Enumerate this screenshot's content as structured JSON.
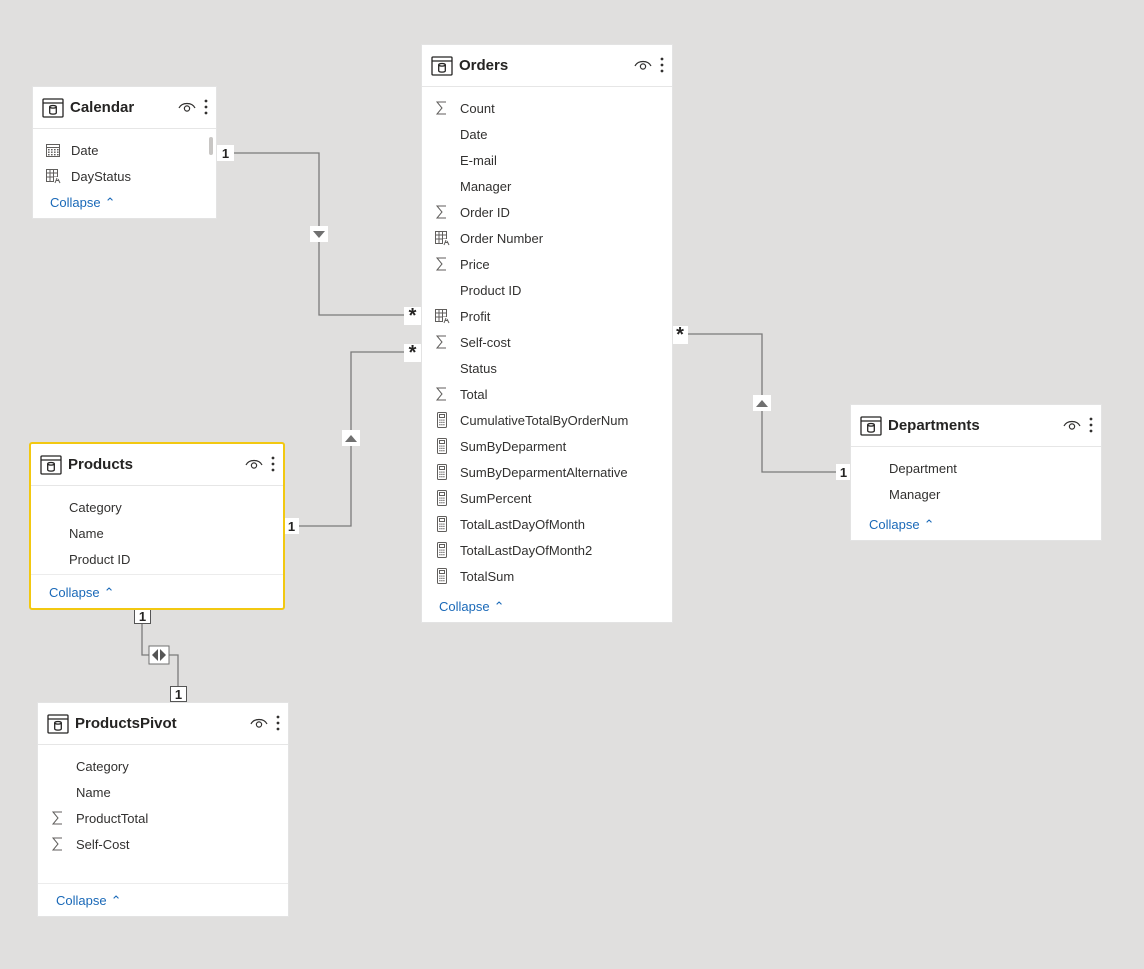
{
  "tables": {
    "calendar": {
      "title": "Calendar",
      "fields": [
        {
          "name": "Date",
          "icon": "calendar-icon"
        },
        {
          "name": "DayStatus",
          "icon": "calculated-column-icon"
        }
      ],
      "collapse": "Collapse"
    },
    "orders": {
      "title": "Orders",
      "fields": [
        {
          "name": "Count",
          "icon": "sigma-icon"
        },
        {
          "name": "Date",
          "icon": ""
        },
        {
          "name": "E-mail",
          "icon": ""
        },
        {
          "name": "Manager",
          "icon": ""
        },
        {
          "name": "Order ID",
          "icon": "sigma-icon"
        },
        {
          "name": "Order Number",
          "icon": "calculated-column-icon"
        },
        {
          "name": "Price",
          "icon": "sigma-icon"
        },
        {
          "name": "Product ID",
          "icon": ""
        },
        {
          "name": "Profit",
          "icon": "calculated-column-icon"
        },
        {
          "name": "Self-cost",
          "icon": "sigma-icon"
        },
        {
          "name": "Status",
          "icon": ""
        },
        {
          "name": "Total",
          "icon": "sigma-icon"
        },
        {
          "name": "CumulativeTotalByOrderNum",
          "icon": "measure-icon"
        },
        {
          "name": "SumByDeparment",
          "icon": "measure-icon"
        },
        {
          "name": "SumByDeparmentAlternative",
          "icon": "measure-icon"
        },
        {
          "name": "SumPercent",
          "icon": "measure-icon"
        },
        {
          "name": "TotalLastDayOfMonth",
          "icon": "measure-icon"
        },
        {
          "name": "TotalLastDayOfMonth2",
          "icon": "measure-icon"
        },
        {
          "name": "TotalSum",
          "icon": "measure-icon"
        }
      ],
      "collapse": "Collapse"
    },
    "products": {
      "title": "Products",
      "fields": [
        {
          "name": "Category",
          "icon": ""
        },
        {
          "name": "Name",
          "icon": ""
        },
        {
          "name": "Product ID",
          "icon": ""
        }
      ],
      "collapse": "Collapse"
    },
    "departments": {
      "title": "Departments",
      "fields": [
        {
          "name": "Department",
          "icon": ""
        },
        {
          "name": "Manager",
          "icon": ""
        }
      ],
      "collapse": "Collapse"
    },
    "productspivot": {
      "title": "ProductsPivot",
      "fields": [
        {
          "name": "Category",
          "icon": ""
        },
        {
          "name": "Name",
          "icon": ""
        },
        {
          "name": "ProductTotal",
          "icon": "sigma-icon"
        },
        {
          "name": "Self-Cost",
          "icon": "sigma-icon"
        }
      ],
      "collapse": "Collapse"
    }
  },
  "relationships": {
    "one_label": "1",
    "many_label": "*"
  },
  "colors": {
    "selected_border": "#f2c811",
    "link_blue": "#1a69b8",
    "canvas_bg": "#e0dfde",
    "line": "#7a7a7a"
  }
}
